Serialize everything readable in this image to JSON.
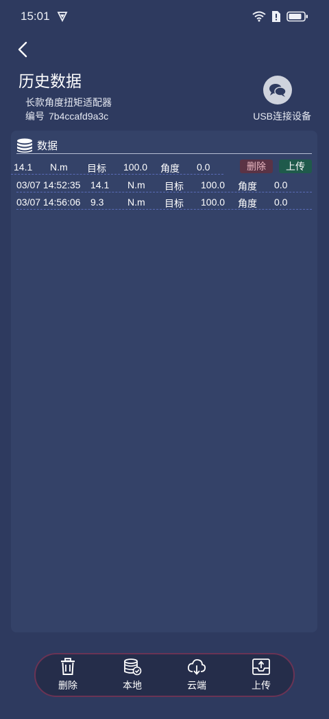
{
  "status": {
    "time": "15:01"
  },
  "header": {
    "title": "历史数据",
    "device_name": "长款角度扭矩适配器",
    "device_id_label": "编号",
    "device_id": "7b4ccafd9a3c",
    "usb_label": "USB连接设备"
  },
  "panel": {
    "title": "数据",
    "rows": [
      {
        "time": "",
        "value": "14.1",
        "unit": "N.m",
        "target_label": "目标",
        "target": "100.0",
        "angle_label": "角度",
        "angle": "0.0"
      },
      {
        "time": "03/07 14:52:35",
        "value": "14.1",
        "unit": "N.m",
        "target_label": "目标",
        "target": "100.0",
        "angle_label": "角度",
        "angle": "0.0"
      },
      {
        "time": "03/07 14:56:06",
        "value": "9.3",
        "unit": "N.m",
        "target_label": "目标",
        "target": "100.0",
        "angle_label": "角度",
        "angle": "0.0"
      }
    ],
    "delete_label": "删除",
    "upload_label": "上传"
  },
  "bottom_nav": {
    "items": [
      {
        "label": "删除",
        "icon": "trash-icon"
      },
      {
        "label": "本地",
        "icon": "database-icon"
      },
      {
        "label": "云端",
        "icon": "cloud-download-icon"
      },
      {
        "label": "上传",
        "icon": "tray-upload-icon"
      }
    ]
  }
}
